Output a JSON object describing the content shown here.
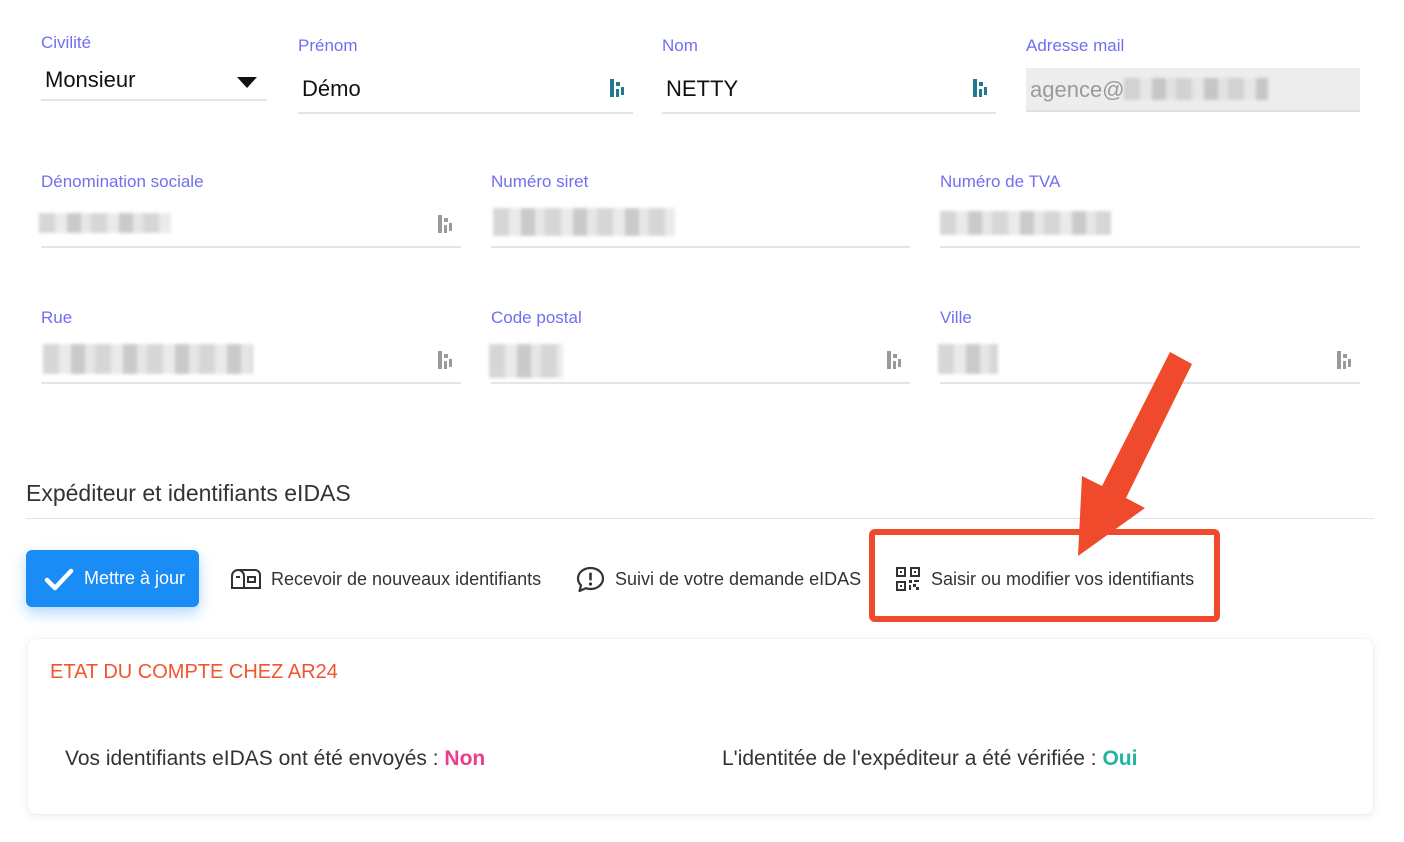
{
  "form": {
    "row1": {
      "civilite": {
        "label": "Civilité",
        "value": "Monsieur"
      },
      "prenom": {
        "label": "Prénom",
        "value": "Démo"
      },
      "nom": {
        "label": "Nom",
        "value": "NETTY"
      },
      "email": {
        "label": "Adresse mail",
        "value": "agence@"
      }
    },
    "row2": {
      "denomination": {
        "label": "Dénomination sociale"
      },
      "siret": {
        "label": "Numéro siret"
      },
      "tva": {
        "label": "Numéro de TVA"
      }
    },
    "row3": {
      "rue": {
        "label": "Rue"
      },
      "code_postal": {
        "label": "Code postal"
      },
      "ville": {
        "label": "Ville"
      }
    }
  },
  "section": {
    "title": "Expéditeur et identifiants eIDAS"
  },
  "actions": {
    "update_label": "Mettre à jour",
    "receive_label": "Recevoir de nouveaux identifiants",
    "follow_label": "Suivi de votre demande eIDAS",
    "edit_label": "Saisir ou modifier vos identifiants"
  },
  "account_card": {
    "title": "ETAT DU COMPTE CHEZ AR24",
    "sent_text": "Vos identifiants eIDAS ont été envoyés :",
    "sent_value": "Non",
    "verified_text": "L'identitée de l'expéditeur a été vérifiée :",
    "verified_value": "Oui"
  },
  "colors": {
    "label": "#6f6ff0",
    "primary": "#1a8cf5",
    "annotation": "#f04a2c",
    "no": "#ec3d8a",
    "yes": "#21b5a0"
  },
  "icons": [
    "check-icon",
    "mailbox-icon",
    "alert-bubble-icon",
    "qr-code-icon",
    "dashlane-icon",
    "chevron-down-icon"
  ]
}
